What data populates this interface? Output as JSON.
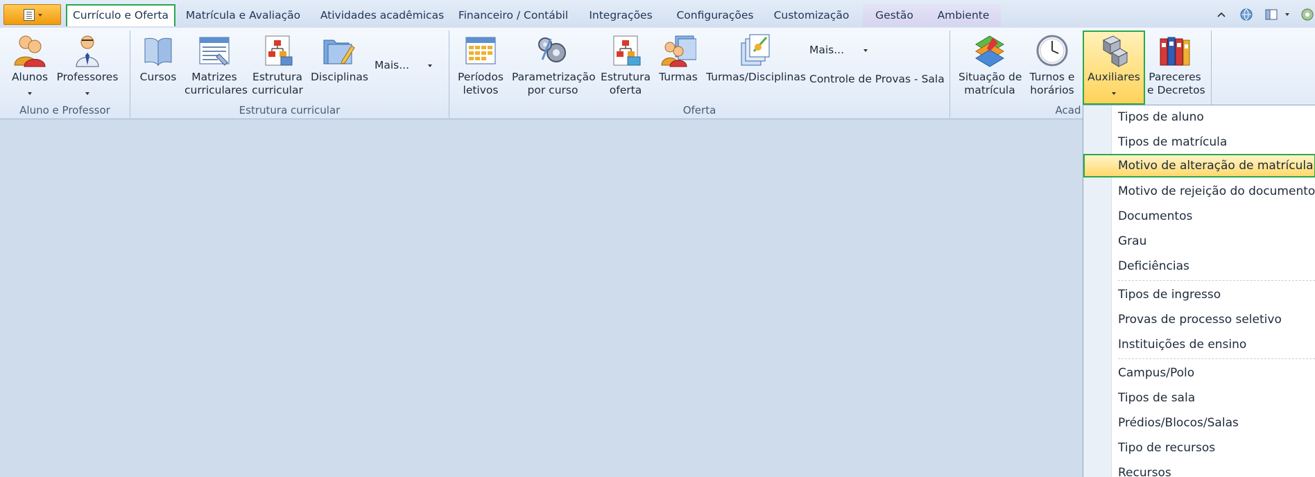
{
  "tabs": [
    {
      "label": "Currículo e Oferta",
      "active": true
    },
    {
      "label": "Matrícula e Avaliação"
    },
    {
      "label": "Atividades acadêmicas"
    },
    {
      "label": "Financeiro / Contábil"
    },
    {
      "label": "Integrações"
    },
    {
      "label": "Configurações"
    },
    {
      "label": "Customização"
    },
    {
      "label": "Gestão"
    },
    {
      "label": "Ambiente"
    }
  ],
  "groups": {
    "aluno_professor": {
      "label": "Aluno e Professor",
      "buttons": [
        {
          "label": "Alunos"
        },
        {
          "label": "Professores"
        }
      ]
    },
    "estrutura": {
      "label": "Estrutura curricular",
      "buttons": [
        {
          "label": "Cursos"
        },
        {
          "label": "Matrizes\ncurriculares"
        },
        {
          "label": "Estrutura\ncurricular"
        },
        {
          "label": "Disciplinas"
        }
      ],
      "more": "Mais..."
    },
    "oferta": {
      "label": "Oferta",
      "buttons": [
        {
          "label": "Períodos\nletivos"
        },
        {
          "label": "Parametrização\npor curso"
        },
        {
          "label": "Estrutura\noferta"
        },
        {
          "label": "Turmas"
        },
        {
          "label": "Turmas/Disciplinas"
        }
      ],
      "more": "Mais...",
      "controle": "Controle de Provas - Sala"
    },
    "academico": {
      "label": "Acad",
      "buttons": [
        {
          "label": "Situação de\nmatrícula"
        },
        {
          "label": "Turnos e\nhorários"
        },
        {
          "label": "Auxiliares"
        },
        {
          "label": "Pareceres\ne Decretos"
        }
      ]
    }
  },
  "menu": {
    "items": [
      {
        "label": "Tipos de aluno"
      },
      {
        "label": "Tipos de matrícula"
      },
      {
        "label": "Motivo de alteração de matrícula",
        "highlighted": true
      },
      {
        "label": "Motivo de rejeição do documento"
      },
      {
        "label": "Documentos"
      },
      {
        "label": "Grau"
      },
      {
        "label": "Deficiências"
      },
      {
        "label": "Tipos de ingresso"
      },
      {
        "label": "Provas de processo seletivo"
      },
      {
        "label": "Instituições de ensino"
      },
      {
        "label": "Campus/Polo"
      },
      {
        "label": "Tipos de sala"
      },
      {
        "label": "Prédios/Blocos/Salas"
      },
      {
        "label": "Tipo de recursos"
      },
      {
        "label": "Recursos"
      }
    ]
  },
  "colors": {
    "accent_green": "#2aa84a",
    "highlight": "#ffd35a",
    "app_button": "#f19a0c"
  }
}
